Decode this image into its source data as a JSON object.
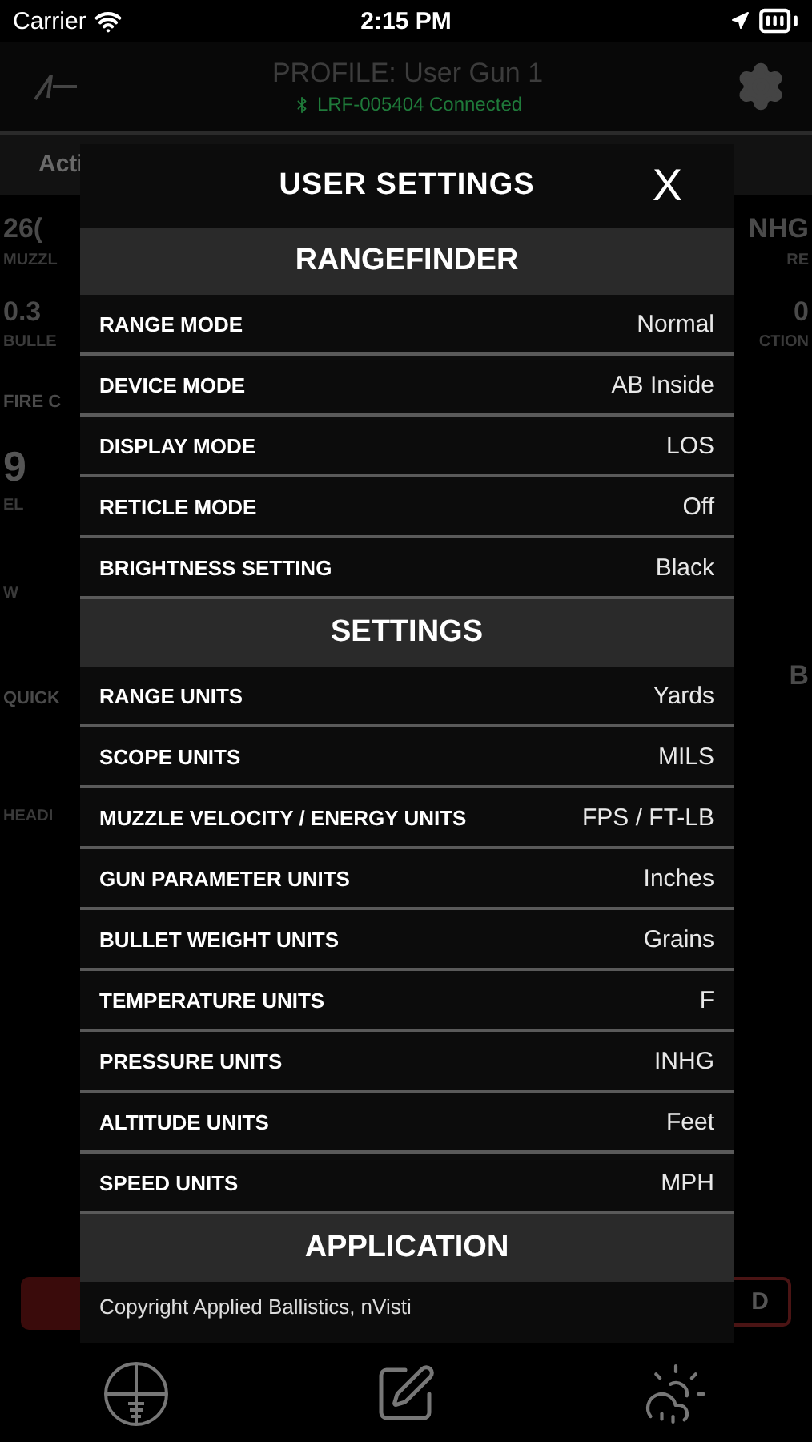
{
  "status_bar": {
    "carrier": "Carrier",
    "time": "2:15 PM"
  },
  "header": {
    "title": "PROFILE: User Gun 1",
    "connection": "LRF-005404 Connected"
  },
  "background": {
    "tab": "Acti",
    "left": [
      {
        "kind": "value",
        "text": "26("
      },
      {
        "kind": "caption",
        "text": "MUZZL"
      },
      {
        "kind": "value",
        "text": "0.3"
      },
      {
        "kind": "caption",
        "text": "BULLE"
      },
      {
        "kind": "heading",
        "text": "FIRE C"
      },
      {
        "kind": "big",
        "text": "9"
      },
      {
        "kind": "caption",
        "text": "EL"
      },
      {
        "kind": "caption",
        "text": "W"
      },
      {
        "kind": "heading",
        "text": "QUICK"
      },
      {
        "kind": "caption",
        "text": "HEADI"
      }
    ],
    "right": [
      {
        "kind": "value",
        "text": "NHG"
      },
      {
        "kind": "caption",
        "text": "RE"
      },
      {
        "kind": "value",
        "text": "0"
      },
      {
        "kind": "caption",
        "text": "CTION"
      },
      {
        "kind": "value",
        "text": "B"
      }
    ],
    "button_right": "D"
  },
  "modal": {
    "title": "USER SETTINGS",
    "close": "X",
    "sections": [
      {
        "title": "RANGEFINDER",
        "rows": [
          {
            "label": "RANGE MODE",
            "value": "Normal"
          },
          {
            "label": "DEVICE MODE",
            "value": "AB Inside"
          },
          {
            "label": "DISPLAY MODE",
            "value": "LOS"
          },
          {
            "label": "RETICLE MODE",
            "value": "Off"
          },
          {
            "label": "BRIGHTNESS SETTING",
            "value": "Black"
          }
        ]
      },
      {
        "title": "SETTINGS",
        "rows": [
          {
            "label": "RANGE UNITS",
            "value": "Yards"
          },
          {
            "label": "SCOPE UNITS",
            "value": "MILS"
          },
          {
            "label": "MUZZLE VELOCITY / ENERGY UNITS",
            "value": "FPS / FT-LB"
          },
          {
            "label": "GUN PARAMETER UNITS",
            "value": "Inches"
          },
          {
            "label": "BULLET WEIGHT UNITS",
            "value": "Grains"
          },
          {
            "label": "TEMPERATURE UNITS",
            "value": "F"
          },
          {
            "label": "PRESSURE UNITS",
            "value": "INHG"
          },
          {
            "label": "ALTITUDE UNITS",
            "value": "Feet"
          },
          {
            "label": "SPEED UNITS",
            "value": "MPH"
          }
        ]
      },
      {
        "title": "APPLICATION",
        "lines": [
          "Copyright Applied Ballistics, nVisti"
        ]
      }
    ]
  }
}
